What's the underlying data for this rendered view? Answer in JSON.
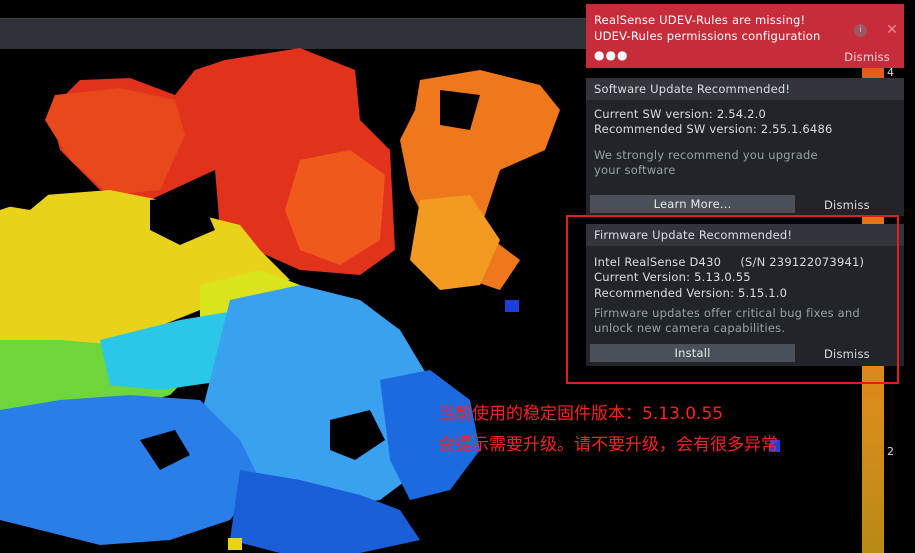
{
  "colors": {
    "alert_red": "#c62c3a",
    "panel": "#212428",
    "annotation": "#ff2020"
  },
  "scale": {
    "top_label": "4",
    "bottom_label": "2"
  },
  "udev_alert": {
    "line1": "RealSense UDEV-Rules are missing!",
    "line2": "UDEV-Rules permissions configuration",
    "dots": "●●●",
    "dismiss": "Dismiss",
    "info_icon": "i",
    "close_icon": "✕"
  },
  "software_update": {
    "title": "Software Update Recommended!",
    "current": "Current SW version: 2.54.2.0",
    "recommended": "Recommended SW version: 2.55.1.6486",
    "message1": "We strongly recommend you upgrade",
    "message2": "your software",
    "learn_more": "Learn More...",
    "dismiss": "Dismiss"
  },
  "firmware_update": {
    "title": "Firmware Update Recommended!",
    "device": "Intel RealSense D430     (S/N 239122073941)",
    "current": "Current Version: 5.13.0.55",
    "recommended": "Recommended Version: 5.15.1.0",
    "message1": "Firmware updates offer critical bug fixes and",
    "message2": "unlock new camera capabilities.",
    "install": "Install",
    "dismiss": "Dismiss"
  },
  "annotation": {
    "line1": "当前使用的稳定固件版本：5.13.0.55",
    "line2": "会提示需要升级。请不要升级，会有很多异常"
  }
}
